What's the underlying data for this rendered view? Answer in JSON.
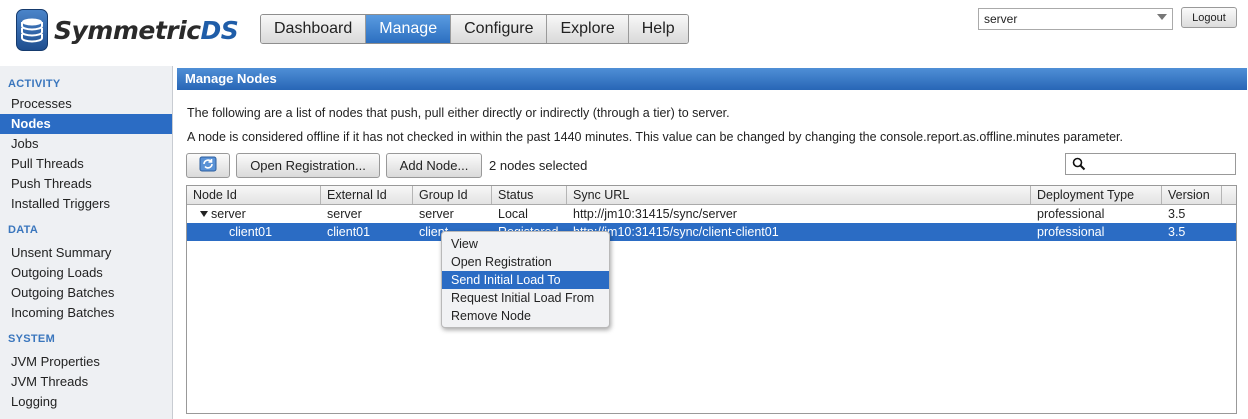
{
  "header": {
    "logo_text_main": "Symmetric",
    "logo_text_accent": "DS",
    "nav_tabs": [
      {
        "label": "Dashboard",
        "active": false
      },
      {
        "label": "Manage",
        "active": true
      },
      {
        "label": "Configure",
        "active": false
      },
      {
        "label": "Explore",
        "active": false
      },
      {
        "label": "Help",
        "active": false
      }
    ],
    "node_selector_value": "server",
    "logout_label": "Logout"
  },
  "sidebar": {
    "sections": [
      {
        "title": "ACTIVITY",
        "items": [
          "Processes",
          "Nodes",
          "Jobs",
          "Pull Threads",
          "Push Threads",
          "Installed Triggers"
        ]
      },
      {
        "title": "DATA",
        "items": [
          "Unsent Summary",
          "Outgoing Loads",
          "Outgoing Batches",
          "Incoming Batches"
        ]
      },
      {
        "title": "SYSTEM",
        "items": [
          "JVM Properties",
          "JVM Threads",
          "Logging"
        ]
      }
    ],
    "active_item": "Nodes"
  },
  "panel": {
    "title": "Manage Nodes",
    "info_line_1": "The following are a list of nodes that push, pull either directly or indirectly (through a tier) to server.",
    "info_line_2": "A node is considered offline if it has not checked in within the past 1440 minutes. This value can be changed by changing the console.report.as.offline.minutes parameter.",
    "refresh_icon": "refresh-icon",
    "open_registration_label": "Open Registration...",
    "add_node_label": "Add Node...",
    "selected_count_text": "2 nodes selected",
    "filter_value": ""
  },
  "grid": {
    "columns": [
      "Node Id",
      "External Id",
      "Group Id",
      "Status",
      "Sync URL",
      "Deployment Type",
      "Version"
    ],
    "rows": [
      {
        "node_id": "server",
        "external_id": "server",
        "group_id": "server",
        "status": "Local",
        "sync_url": "http://jm10:31415/sync/server",
        "deployment_type": "professional",
        "version": "3.5",
        "selected": false,
        "expanded": true,
        "depth": 0
      },
      {
        "node_id": "client01",
        "external_id": "client01",
        "group_id": "client",
        "status": "Registered",
        "sync_url": "http://jm10:31415/sync/client-client01",
        "deployment_type": "professional",
        "version": "3.5",
        "selected": true,
        "expanded": false,
        "depth": 1
      }
    ]
  },
  "context_menu": {
    "items": [
      "View",
      "Open Registration",
      "Send Initial Load To",
      "Request Initial Load From",
      "Remove Node"
    ],
    "highlighted": "Send Initial Load To"
  },
  "colors": {
    "accent": "#2b6cc4",
    "panel_title_bg": "#3877c6",
    "sidebar_bg": "#eef0f3"
  }
}
